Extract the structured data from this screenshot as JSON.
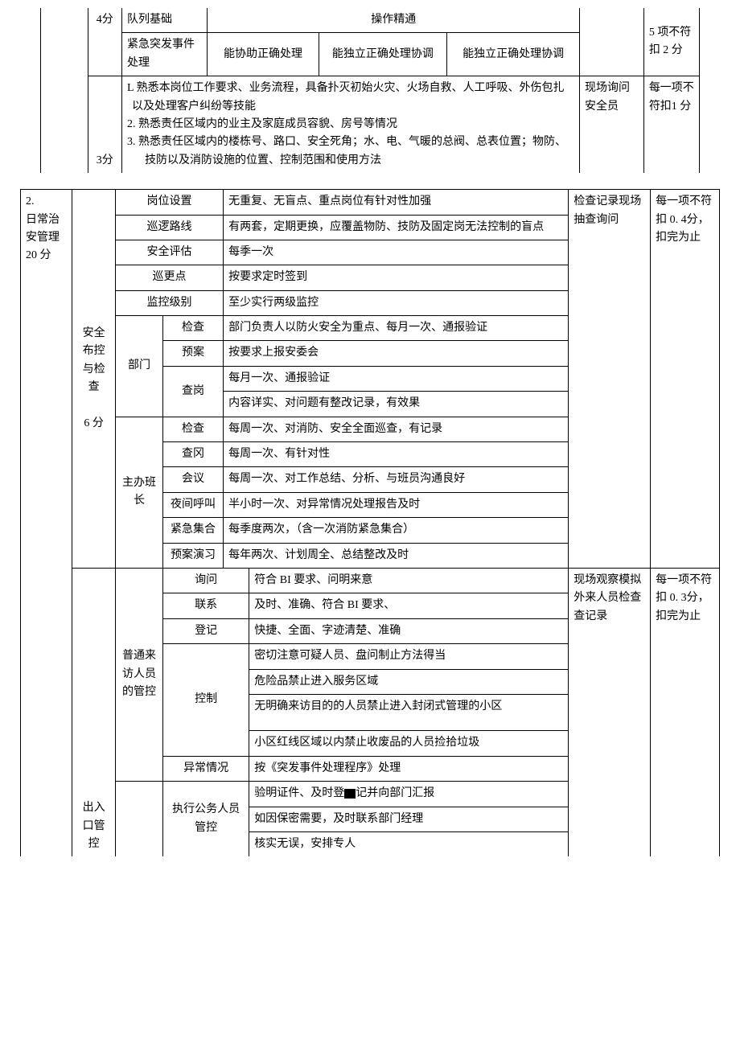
{
  "t1": {
    "r1": {
      "c1": "4分",
      "c2": "队列基础",
      "c3": "操作精通",
      "c4": "5 项不符扣 2 分"
    },
    "r2": {
      "c1": "紧急突发事件处理",
      "c2": "能协助正确处理",
      "c3": "能独立正确处理协调",
      "c4": "能独立正确处理协调"
    },
    "r3": {
      "c1": "3分",
      "c2l1": "L 熟悉本岗位工作要求、业务流程，具备扑灭初始火灾、火场自救、人工呼吸、外伤包扎以及处理客户纠纷等技能",
      "c2l2": "2. 熟悉责任区域内的业主及家庭成员容貌、房号等情况",
      "c2l3": "3. 熟悉责任区域内的楼栋号、路口、安全死角；水、电、气暖的总阀、总表位置；物防、技防以及消防设施的位置、控制范围和使用方法",
      "c3": "现场询问安全员",
      "c4": "每一项不符扣1 分"
    }
  },
  "t2": {
    "section": {
      "num": "2.",
      "title": "日常治安管理",
      "score": "20 分"
    },
    "col2a": "安全布控与检查",
    "col2a_score": "6 分",
    "col2b": "出入口管控",
    "col3a": "部门",
    "col3b": "主办班长",
    "col3c": "普通来访人员的管控",
    "rows_top": [
      {
        "a": "岗位设置",
        "b": "无重复、无盲点、重点岗位有针对性加强"
      },
      {
        "a": "巡逻路线",
        "b": "有两套，定期更换，应覆盖物防、技防及固定岗无法控制的盲点"
      },
      {
        "a": "安全评估",
        "b": "每季一次"
      },
      {
        "a": "巡更点",
        "b": "按要求定时签到"
      },
      {
        "a": "监控级别",
        "b": "至少实行两级监控"
      }
    ],
    "dept": [
      {
        "a": "检查",
        "b": "部门负责人以防火安全为重点、每月一次、通报验证"
      },
      {
        "a": "预案",
        "b": "按要求上报安委会"
      },
      {
        "a": "查岗",
        "b1": "每月一次、通报验证",
        "b2": "内容详实、对问题有整改记录，有效果"
      }
    ],
    "leader": [
      {
        "a": "检查",
        "b": "每周一次、对消防、安全全面巡查，有记录"
      },
      {
        "a": "查冈",
        "b": "每周一次、有针对性"
      },
      {
        "a": "会议",
        "b": "每周一次、对工作总结、分析、与班员沟通良好"
      },
      {
        "a": "夜间呼叫",
        "b": "半小时一次、对异常情况处理报告及时"
      },
      {
        "a": "紧急集合",
        "b": "每季度两次，（含一次消防紧急集合）"
      },
      {
        "a": "预案演习",
        "b": "每年两次、计划周全、总结整改及时"
      }
    ],
    "visitor": {
      "ask": {
        "a": "询问",
        "b": "符合 BI 要求、问明来意"
      },
      "contact": {
        "a": "联系",
        "b": "及时、准确、符合 BI 要求、"
      },
      "reg": {
        "a": "登记",
        "b": "快捷、全面、字迹清楚、准确"
      },
      "ctrl": {
        "a": "控制",
        "b1": "密切注意可疑人员、盘问制止方法得当",
        "b2": "危险品禁止进入服务区域",
        "b3": "无明确来访目的的人员禁止进入封闭式管理的小区",
        "b4": "小区红线区域以内禁止收废品的人员捡拾垃圾"
      },
      "abn": {
        "a": "异常情况",
        "b": "按《突发事件处理程序》处理"
      },
      "official": {
        "a": "执行公务人员管控",
        "b1": "验明证件、及时登",
        "b1b": "记并向部门汇报",
        "b2": "如因保密需要，及时联系部门经理",
        "b3": "核实无误，安排专人"
      }
    },
    "check1": "检查记录现场抽查询问",
    "score1": "每一项不符扣 0. 4分，扣完为止",
    "check2": "现场观察模拟外来人员检查查记录",
    "score2": "每一项不符扣 0. 3分，扣完为止"
  }
}
